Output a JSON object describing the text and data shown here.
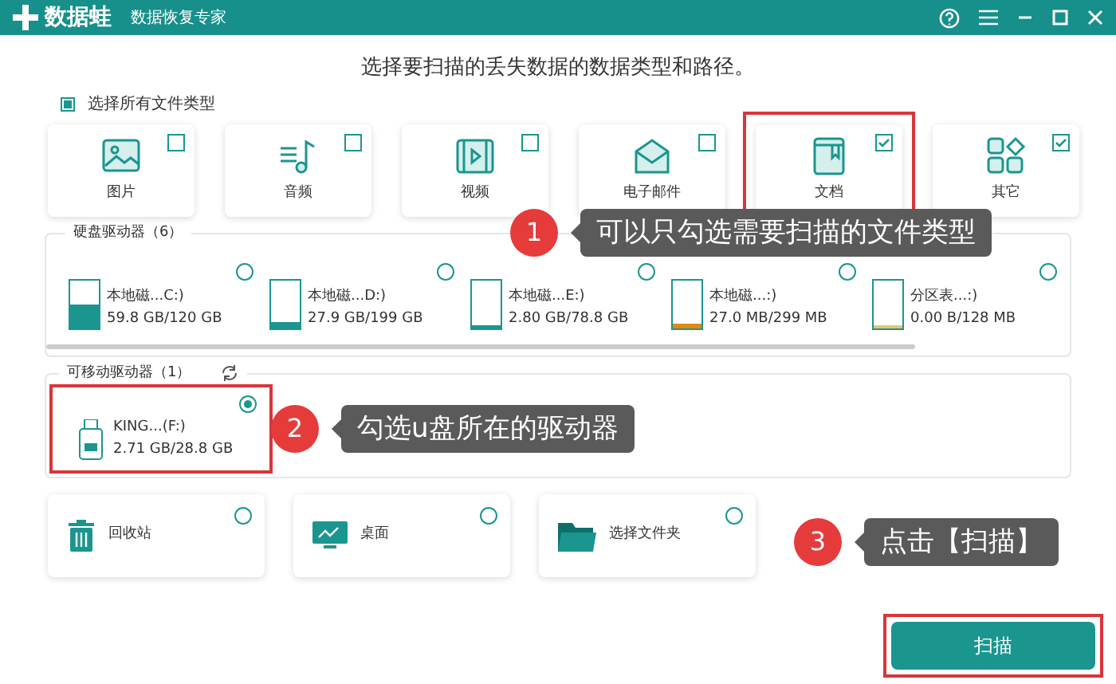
{
  "app": {
    "name": "数据蛙",
    "subtitle": "数据恢复专家"
  },
  "heading": "选择要扫描的丢失数据的数据类型和路径。",
  "select_all": {
    "label": "选择所有文件类型",
    "checked": true
  },
  "file_types": [
    {
      "kind": "image",
      "label": "图片",
      "checked": false,
      "highlighted": false
    },
    {
      "kind": "audio",
      "label": "音频",
      "checked": false,
      "highlighted": false
    },
    {
      "kind": "video",
      "label": "视频",
      "checked": false,
      "highlighted": false
    },
    {
      "kind": "email",
      "label": "电子邮件",
      "checked": false,
      "highlighted": false
    },
    {
      "kind": "document",
      "label": "文档",
      "checked": true,
      "highlighted": true
    },
    {
      "kind": "other",
      "label": "其它",
      "checked": true,
      "highlighted": false
    }
  ],
  "hard_drives": {
    "title": "硬盘驱动器（6）",
    "items": [
      {
        "name": "本地磁...C:)",
        "reading": "59.8 GB/120 GB",
        "level": 0.5,
        "color": "#1a968f",
        "selected": false
      },
      {
        "name": "本地磁...D:)",
        "reading": "27.9 GB/199 GB",
        "level": 0.14,
        "color": "#1a968f",
        "selected": false
      },
      {
        "name": "本地磁...E:)",
        "reading": "2.80 GB/78.8 GB",
        "level": 0.04,
        "color": "#1a968f",
        "selected": false
      },
      {
        "name": "本地磁...:)",
        "reading": "27.0 MB/299 MB",
        "level": 0.09,
        "color": "#e08a12",
        "selected": false
      },
      {
        "name": "分区表...:)",
        "reading": "0.00  B/128 MB",
        "level": 0,
        "color": "#e8c470",
        "selected": false
      }
    ]
  },
  "removable_drives": {
    "title": "可移动驱动器（1）",
    "items": [
      {
        "name": "KING...(F:)",
        "reading": "2.71 GB/28.8 GB",
        "selected": true,
        "highlighted": true
      }
    ]
  },
  "locations": [
    {
      "kind": "recycle",
      "label": "回收站",
      "selected": false
    },
    {
      "kind": "desktop",
      "label": "桌面",
      "selected": false
    },
    {
      "kind": "folder",
      "label": "选择文件夹",
      "selected": false
    }
  ],
  "scan_button": {
    "label": "扫描",
    "highlighted": true
  },
  "callouts": [
    {
      "number": "1",
      "text": "可以只勾选需要扫描的文件类型"
    },
    {
      "number": "2",
      "text": "勾选u盘所在的驱动器"
    },
    {
      "number": "3",
      "text": "点击【扫描】"
    }
  ]
}
